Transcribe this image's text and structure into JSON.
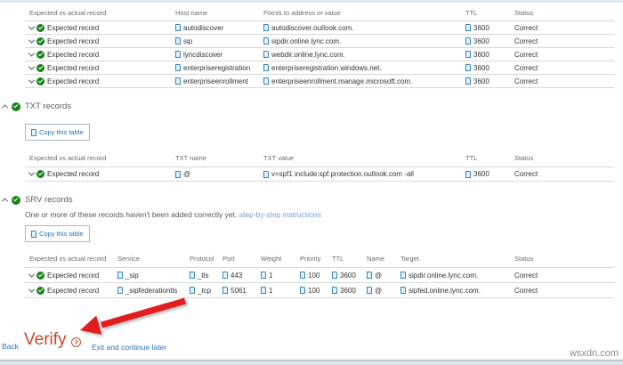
{
  "colors": {
    "success_green": "#178217",
    "verify_accent": "#c3492b",
    "link_blue": "#2574bb",
    "annotation_red": "#e11d1d"
  },
  "cname": {
    "headers": [
      "Expected vs actual record",
      "Host name",
      "Points to address or value",
      "TTL",
      "Status"
    ],
    "rows": [
      {
        "expected": "Expected record",
        "host": "autodiscover",
        "points": "autodiscover.outlook.com.",
        "ttl": "3600",
        "status": "Correct"
      },
      {
        "expected": "Expected record",
        "host": "sip",
        "points": "sipdir.online.lync.com.",
        "ttl": "3600",
        "status": "Correct"
      },
      {
        "expected": "Expected record",
        "host": "lyncdiscover",
        "points": "webdir.online.lync.com.",
        "ttl": "3600",
        "status": "Correct"
      },
      {
        "expected": "Expected record",
        "host": "enterpriseregistration",
        "points": "enterpriseregistration.windows.net.",
        "ttl": "3600",
        "status": "Correct"
      },
      {
        "expected": "Expected record",
        "host": "enterpriseenrollment",
        "points": "enterpriseenrollment.manage.microsoft.com.",
        "ttl": "3600",
        "status": "Correct"
      }
    ]
  },
  "txt": {
    "title": "TXT records",
    "copy_button": "Copy this table",
    "headers": [
      "Expected vs actual record",
      "TXT name",
      "TXT value",
      "TTL",
      "Status"
    ],
    "rows": [
      {
        "expected": "Expected record",
        "name": "@",
        "value": "v=spf1 include:spf.protection.outlook.com -all",
        "ttl": "3600",
        "status": "Correct"
      }
    ]
  },
  "srv": {
    "title": "SRV records",
    "description": "One or more of these records haven't been added correctly yet.",
    "link": "step-by-step instructions",
    "copy_button": "Copy this table",
    "headers": [
      "Expected vs actual record",
      "Service",
      "Protocol",
      "Port",
      "Weight",
      "Priority",
      "TTL",
      "Name",
      "Target",
      "Status"
    ],
    "rows": [
      {
        "expected": "Expected record",
        "service": "_sip",
        "protocol": "_tls",
        "port": "443",
        "weight": "1",
        "priority": "100",
        "ttl": "3600",
        "name": "@",
        "target": "sipdir.online.lync.com.",
        "status": "Correct"
      },
      {
        "expected": "Expected record",
        "service": "_sipfederationtls",
        "protocol": "_tcp",
        "port": "5061",
        "weight": "1",
        "priority": "100",
        "ttl": "3600",
        "name": "@",
        "target": "sipfed.online.lync.com.",
        "status": "Correct"
      }
    ]
  },
  "footer": {
    "back": "Back",
    "verify": "Verify",
    "exit": "Exit and continue later"
  },
  "watermark": "wsxdn.com"
}
